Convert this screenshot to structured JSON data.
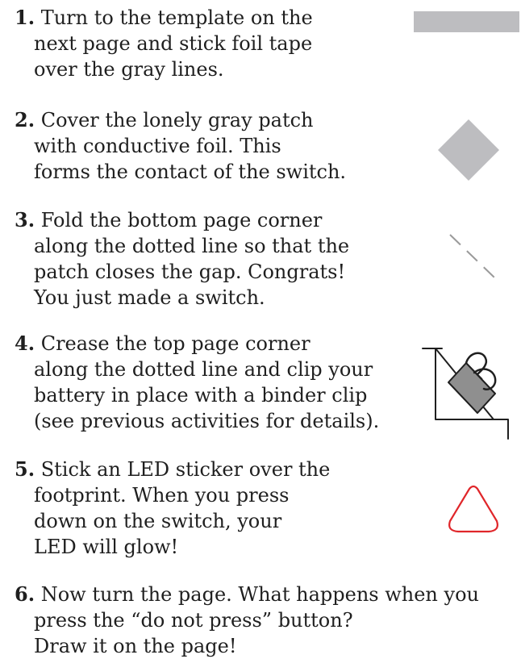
{
  "steps": [
    {
      "number": "1.",
      "lines": [
        "Turn to the template on the",
        "next page and stick foil tape",
        "over the gray lines."
      ]
    },
    {
      "number": "2.",
      "lines": [
        "Cover the lonely gray patch",
        "with conductive foil. This",
        "forms the contact of the switch."
      ]
    },
    {
      "number": "3.",
      "lines": [
        "Fold the bottom page corner",
        "along the dotted line so that the",
        "patch closes the gap. Congrats!",
        "You just made a switch."
      ]
    },
    {
      "number": "4.",
      "lines": [
        "Crease the top page corner",
        "along the dotted line and clip your",
        "battery in place with a binder clip",
        "(see previous activities for details)."
      ]
    },
    {
      "number": "5.",
      "lines": [
        "Stick an LED sticker over the",
        "footprint. When you press",
        "down on the switch, your",
        "LED will glow!"
      ]
    },
    {
      "number": "6.",
      "lines": [
        "Now turn the page. What happens when you",
        "press the “do not press” button?",
        "Draw it on the page!"
      ]
    }
  ],
  "icons": {
    "foil_strip": "gray-bar-icon",
    "foil_patch": "gray-diamond-icon",
    "fold_line": "dotted-line-icon",
    "binder_clip": "binder-clip-icon",
    "led_footprint": "led-footprint-icon"
  },
  "colors": {
    "text": "#1f1f1f",
    "foil_gray": "#bdbdc0",
    "led_red": "#e0262a"
  }
}
